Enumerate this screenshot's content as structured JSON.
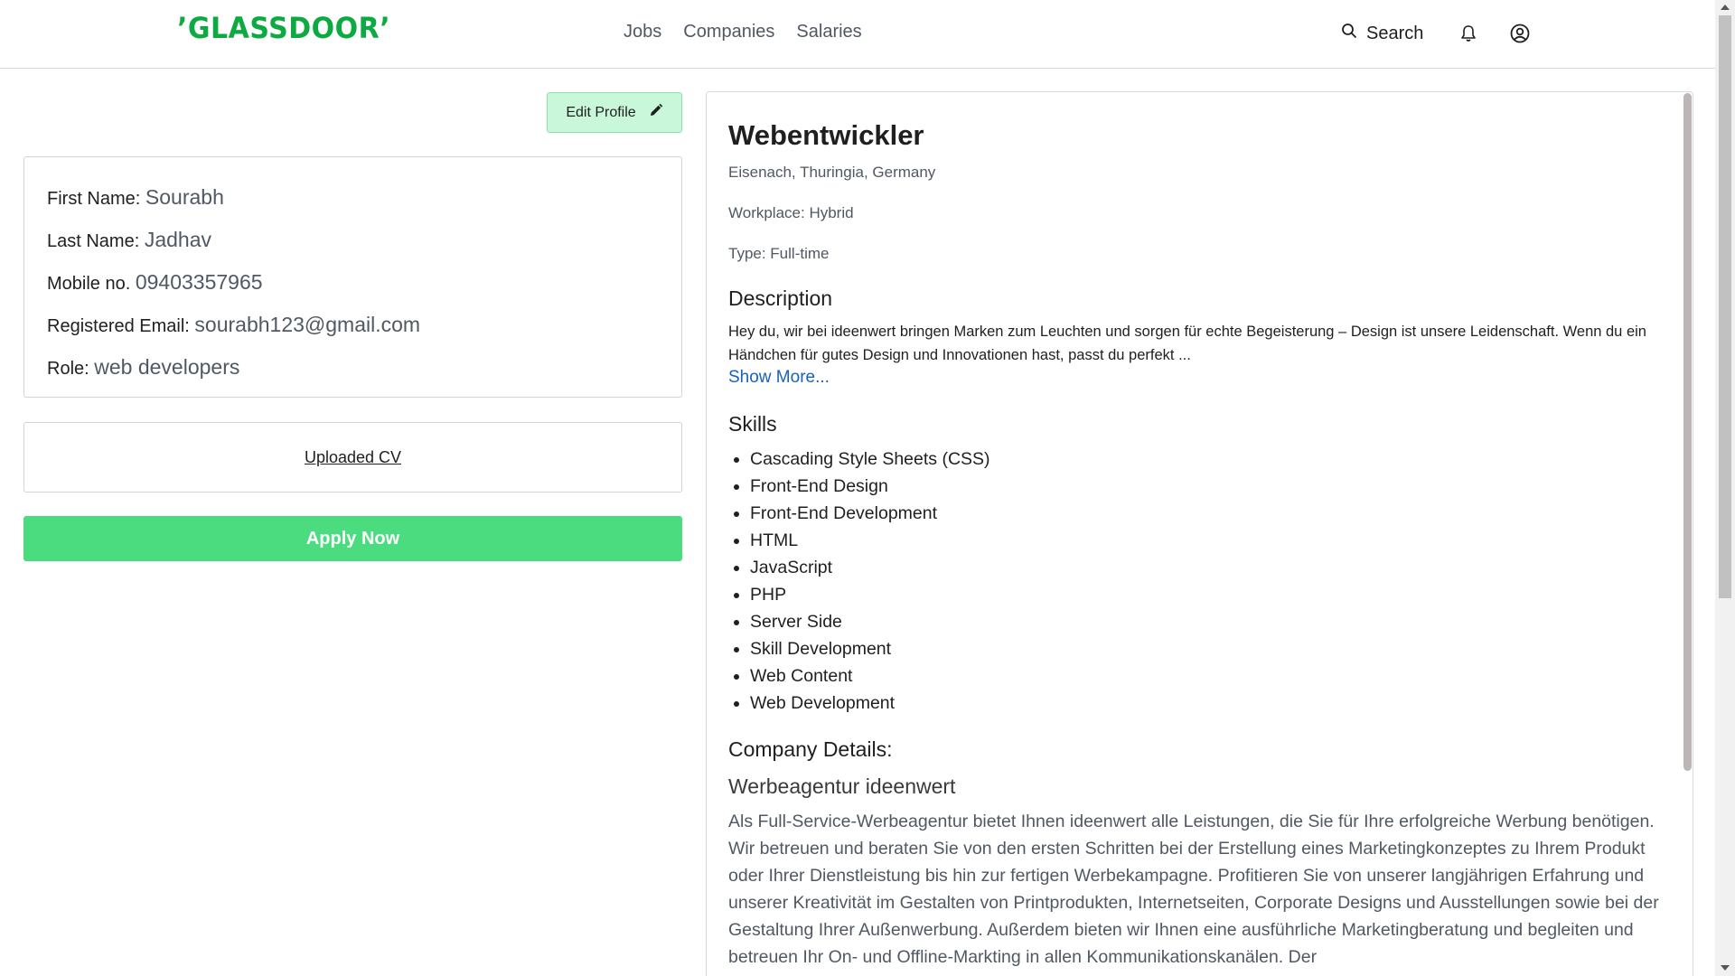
{
  "header": {
    "logo": "’GLASSDOOR’",
    "nav": [
      "Jobs",
      "Companies",
      "Salaries"
    ],
    "search_label": "Search",
    "icons": {
      "search": "search-icon",
      "bell": "bell-icon",
      "account": "account-icon"
    }
  },
  "profile": {
    "edit_label": "Edit Profile",
    "first_name_label": "First Name:",
    "first_name": "Sourabh",
    "last_name_label": "Last Name:",
    "last_name": "Jadhav",
    "mobile_label": "Mobile no.",
    "mobile": "09403357965",
    "email_label": "Registered Email:",
    "email": "sourabh123@gmail.com",
    "role_label": "Role:",
    "role": "web developers",
    "cv_label": "Uploaded CV",
    "apply_label": "Apply Now"
  },
  "job": {
    "title": "Webentwickler",
    "location": "Eisenach, Thuringia, Germany",
    "workplace": "Workplace: Hybrid",
    "type": "Type: Full-time",
    "description_heading": "Description",
    "description": "Hey du, wir bei ideenwert bringen Marken zum Leuchten und sorgen für echte Begeisterung – Design ist unsere Leidenschaft. Wenn du ein Händchen für gutes Design und Innovationen hast, passt du perfekt ...",
    "show_more": "Show More...",
    "skills_heading": "Skills",
    "skills": [
      "Cascading Style Sheets (CSS)",
      "Front-End Design",
      "Front-End Development",
      "HTML",
      "JavaScript",
      "PHP",
      "Server Side",
      "Skill Development",
      "Web Content",
      "Web Development"
    ],
    "company_heading": "Company Details:",
    "company_name": "Werbeagentur ideenwert",
    "company_description": "Als Full-Service-Werbeagentur bietet Ihnen ideenwert alle Leistungen, die Sie für Ihre erfolgreiche Werbung benötigen. Wir betreuen und beraten Sie von den ersten Schritten bei der Erstellung eines Marketingkonzeptes zu Ihrem Produkt oder Ihrer Dienstleistung bis hin zur fertigen Werbekampagne. Profitieren Sie von unserer langjährigen Erfahrung und unserer Kreativität im Gestalten von Printprodukten, Internetseiten, Corporate Designs und Ausstellungen sowie bei der Gestaltung Ihrer Außenwerbung. Außerdem bieten wir Ihnen eine ausführliche Marketingberatung und begleiten und betreuen Ihr On- und Offline-Markting in allen Kommunikationskanälen. Der"
  },
  "colors": {
    "brand": "#0caa41",
    "apply": "#4cdc80",
    "edit_bg": "#c9f7da",
    "link": "#1861bf"
  }
}
